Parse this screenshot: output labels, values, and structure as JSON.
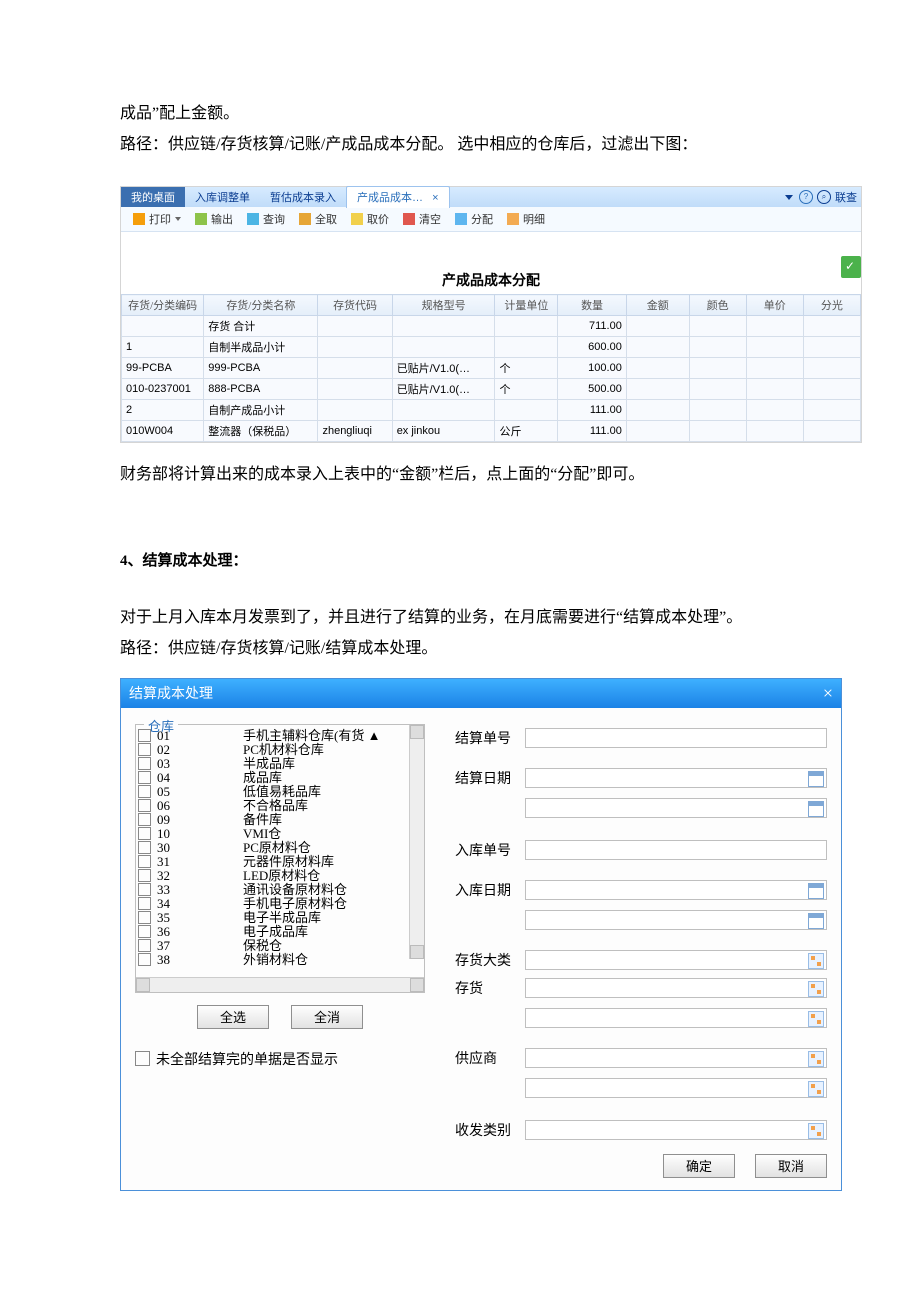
{
  "doc": {
    "intro_line1": "成品”配上金额。",
    "intro_line2": "路径：供应链/存货核算/记账/产成品成本分配。 选中相应的仓库后，过滤出下图：",
    "after_grid": "财务部将计算出来的成本录入上表中的“金额”栏后，点上面的“分配”即可。",
    "section4_title": "4、结算成本处理：",
    "section4_p1": "对于上月入库本月发票到了，并且进行了结算的业务，在月底需要进行“结算成本处理”。",
    "section4_p2": "路径：供应链/存货核算/记账/结算成本处理。"
  },
  "app1": {
    "tabs": {
      "t1": "我的桌面",
      "t2": "入库调整单",
      "t3": "暂估成本录入",
      "t4": "产成品成本…",
      "right_label": "联查"
    },
    "toolbar": {
      "print": "打印",
      "export": "输出",
      "query": "查询",
      "all": "全取",
      "price": "取价",
      "clear": "清空",
      "alloc": "分配",
      "detail": "明细"
    },
    "title": "产成品成本分配",
    "columns": [
      "存货/分类编码",
      "存货/分类名称",
      "存货代码",
      "规格型号",
      "计量单位",
      "数量",
      "金额",
      "颜色",
      "单价",
      "分光"
    ],
    "rows": [
      {
        "code": "",
        "name": "存货 合计",
        "scode": "",
        "spec": "",
        "unit": "",
        "qty": "711.00"
      },
      {
        "code": "1",
        "name": "自制半成品小计",
        "scode": "",
        "spec": "",
        "unit": "",
        "qty": "600.00"
      },
      {
        "code": "99-PCBA",
        "name": "999-PCBA",
        "scode": "",
        "spec": "已贴片/V1.0(…",
        "unit": "个",
        "qty": "100.00"
      },
      {
        "code": "010-0237001",
        "name": "888-PCBA",
        "scode": "",
        "spec": "已贴片/V1.0(…",
        "unit": "个",
        "qty": "500.00"
      },
      {
        "code": "2",
        "name": "自制产成品小计",
        "scode": "",
        "spec": "",
        "unit": "",
        "qty": "111.00"
      },
      {
        "code": "010W004",
        "name": "整流器（保税品）",
        "scode": "zhengliuqi",
        "spec": "ex jinkou",
        "unit": "公斤",
        "qty": "111.00"
      }
    ]
  },
  "dialog": {
    "title": "结算成本处理",
    "close": "×",
    "warehouse_legend": "仓库",
    "warehouses": [
      {
        "code": "01",
        "name": "手机主辅料仓库(有货"
      },
      {
        "code": "02",
        "name": "PC机材料仓库"
      },
      {
        "code": "03",
        "name": "半成品库"
      },
      {
        "code": "04",
        "name": "成品库"
      },
      {
        "code": "05",
        "name": "低值易耗品库"
      },
      {
        "code": "06",
        "name": "不合格品库"
      },
      {
        "code": "09",
        "name": "备件库"
      },
      {
        "code": "10",
        "name": "VMI仓"
      },
      {
        "code": "30",
        "name": "PC原材料仓"
      },
      {
        "code": "31",
        "name": "元器件原材料库"
      },
      {
        "code": "32",
        "name": "LED原材料仓"
      },
      {
        "code": "33",
        "name": "通讯设备原材料仓"
      },
      {
        "code": "34",
        "name": "手机电子原材料仓"
      },
      {
        "code": "35",
        "name": "电子半成品库"
      },
      {
        "code": "36",
        "name": "电子成品库"
      },
      {
        "code": "37",
        "name": "保税仓"
      },
      {
        "code": "38",
        "name": "外销材料仓"
      }
    ],
    "select_all": "全选",
    "select_none": "全消",
    "unfinished_label": "未全部结算完的单据是否显示",
    "fields": {
      "settle_no": "结算单号",
      "settle_date": "结算日期",
      "in_no": "入库单号",
      "in_date": "入库日期",
      "cat": "存货大类",
      "inv": "存货",
      "supplier": "供应商",
      "rdcls": "收发类别"
    },
    "ok": "确定",
    "cancel": "取消"
  }
}
